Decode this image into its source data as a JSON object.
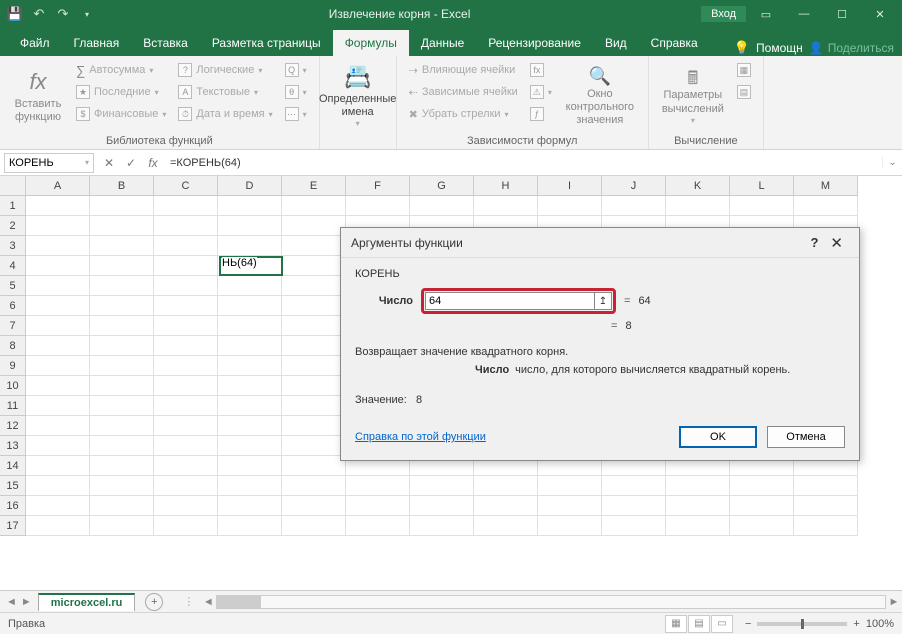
{
  "title": "Извлечение корня - Excel",
  "login": "Вход",
  "tabs": {
    "file": "Файл",
    "home": "Главная",
    "insert": "Вставка",
    "layout": "Разметка страницы",
    "formulas": "Формулы",
    "data": "Данные",
    "review": "Рецензирование",
    "view": "Вид",
    "help": "Справка",
    "tellme": "Помощн",
    "share": "Поделиться"
  },
  "ribbon": {
    "insert_function": "Вставить функцию",
    "autosum": "Автосумма",
    "recent": "Последние",
    "financial": "Финансовые",
    "logical": "Логические",
    "text": "Текстовые",
    "datetime": "Дата и время",
    "library_label": "Библиотека функций",
    "defined_names": "Определенные имена",
    "trace_precedents": "Влияющие ячейки",
    "trace_dependents": "Зависимые ячейки",
    "remove_arrows": "Убрать стрелки",
    "watch_window": "Окно контрольного значения",
    "audit_label": "Зависимости формул",
    "calc_options": "Параметры вычислений",
    "calc_label": "Вычисление"
  },
  "formula_bar": {
    "name": "КОРЕНЬ",
    "formula": "=КОРЕНЬ(64)"
  },
  "grid": {
    "cols": [
      "A",
      "B",
      "C",
      "D",
      "E",
      "F",
      "G",
      "H",
      "I",
      "J",
      "K",
      "L",
      "M"
    ],
    "rows": [
      "1",
      "2",
      "3",
      "4",
      "5",
      "6",
      "7",
      "8",
      "9",
      "10",
      "11",
      "12",
      "13",
      "14",
      "15",
      "16",
      "17"
    ],
    "active_cell_value": "НЬ(64)"
  },
  "dialog": {
    "title": "Аргументы функции",
    "func": "КОРЕНЬ",
    "arg_label": "Число",
    "arg_value": "64",
    "arg_eval": "64",
    "result_preview": "8",
    "description": "Возвращает значение квадратного корня.",
    "arg_name": "Число",
    "arg_desc": "число, для которого вычисляется квадратный корень.",
    "result_label": "Значение:",
    "result_value": "8",
    "help_link": "Справка по этой функции",
    "ok": "OK",
    "cancel": "Отмена"
  },
  "sheet": {
    "name": "microexcel.ru"
  },
  "status": {
    "mode": "Правка",
    "zoom": "100%"
  }
}
